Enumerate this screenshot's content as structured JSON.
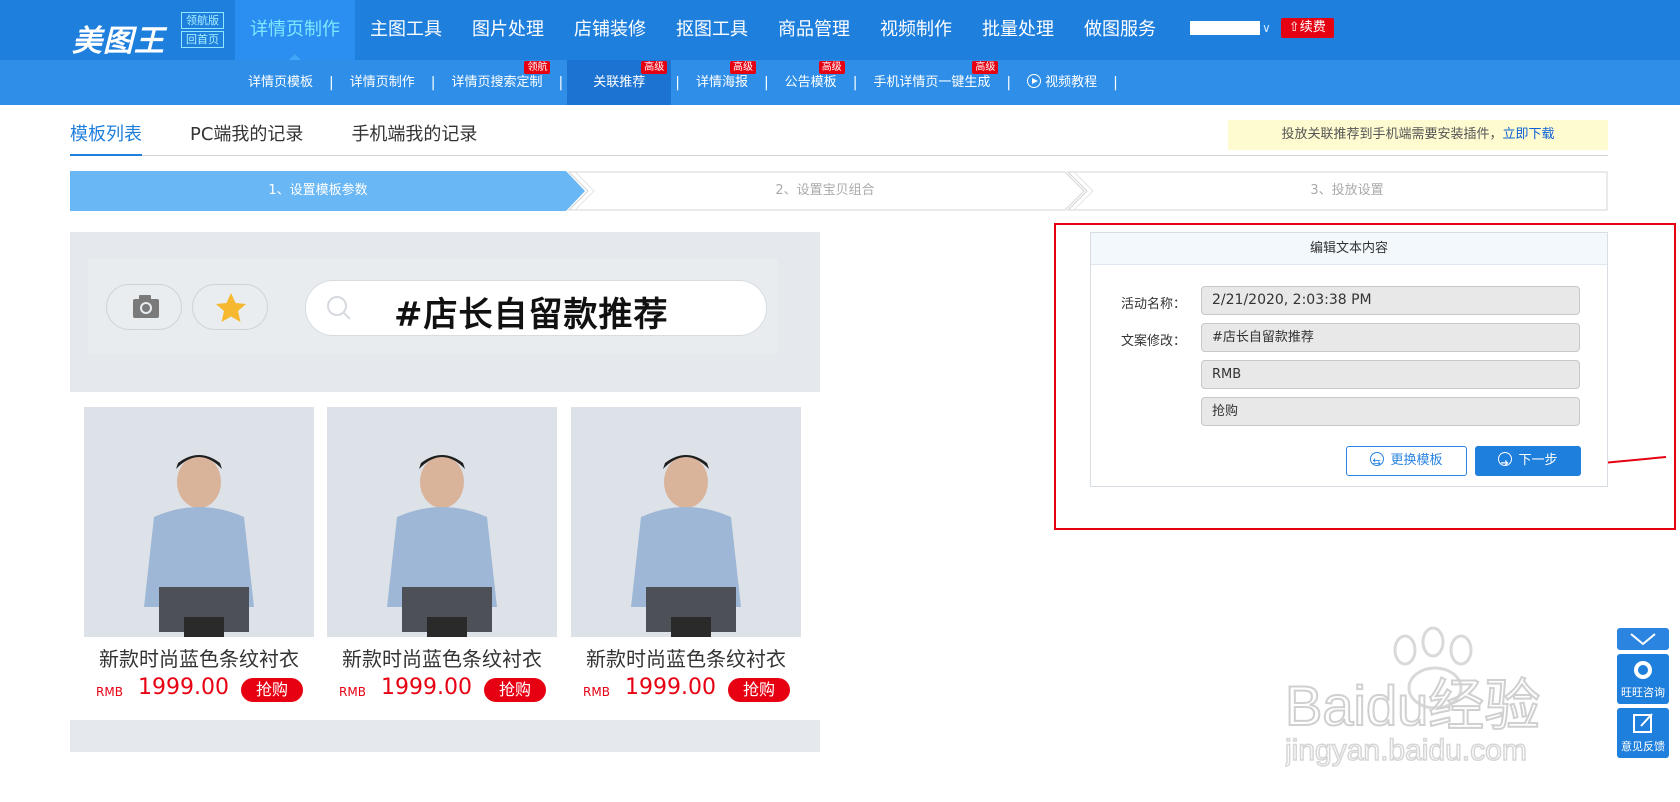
{
  "topbar": {
    "brand": "美图王",
    "badge_top": "领航版",
    "badge_bottom": "回首页",
    "nav": [
      {
        "label": "详情页制作",
        "active": true
      },
      {
        "label": "主图工具"
      },
      {
        "label": "图片处理"
      },
      {
        "label": "店铺装修"
      },
      {
        "label": "抠图工具"
      },
      {
        "label": "商品管理"
      },
      {
        "label": "视频制作"
      },
      {
        "label": "批量处理"
      },
      {
        "label": "做图服务"
      }
    ],
    "user_caret": "∨",
    "renew_label": "续费"
  },
  "subnav": [
    {
      "label": "详情页模板"
    },
    {
      "label": "详情页制作"
    },
    {
      "label": "详情页搜索定制",
      "tag": "领航"
    },
    {
      "label": "关联推荐",
      "tag": "高级",
      "active": true
    },
    {
      "label": "详情海报",
      "tag": "高级"
    },
    {
      "label": "公告模板",
      "tag": "高级"
    },
    {
      "label": "手机详情页一键生成",
      "tag": "高级"
    },
    {
      "label": "视频教程"
    }
  ],
  "tabs": [
    {
      "label": "模板列表",
      "active": true
    },
    {
      "label": "PC端我的记录"
    },
    {
      "label": "手机端我的记录"
    }
  ],
  "notice": {
    "text": "投放关联推荐到手机端需要安装插件，",
    "link": "立即下载"
  },
  "steps": [
    {
      "label": "1、设置模板参数",
      "active": true
    },
    {
      "label": "2、设置宝贝组合"
    },
    {
      "label": "3、投放设置"
    }
  ],
  "preview": {
    "search_text": "#店长自留款推荐",
    "products": [
      {
        "name": "新款时尚蓝色条纹衬衣",
        "currency": "RMB",
        "price": "1999.00",
        "buy": "抢购"
      },
      {
        "name": "新款时尚蓝色条纹衬衣",
        "currency": "RMB",
        "price": "1999.00",
        "buy": "抢购"
      },
      {
        "name": "新款时尚蓝色条纹衬衣",
        "currency": "RMB",
        "price": "1999.00",
        "buy": "抢购"
      }
    ]
  },
  "panel": {
    "title": "编辑文本内容",
    "activity_label": "活动名称：",
    "activity_value": "2/21/2020, 2:03:38 PM",
    "copy_label": "文案修改：",
    "copy_values": [
      "#店长自留款推荐",
      "RMB",
      "抢购"
    ],
    "change_template": "更换模板",
    "next_step": "下一步"
  },
  "side_widgets": {
    "consult": "旺旺咨询",
    "feedback": "意见反馈"
  },
  "watermark": {
    "brand": "Baidu经验",
    "url": "jingyan.baidu.com"
  },
  "colors": {
    "brand_blue": "#1f7fdd",
    "sub_blue": "#2e8ee8",
    "accent_cyan": "#7fe7ff",
    "step_active": "#6ab7f5",
    "price_red": "#e60012",
    "highlight_red": "#e60012"
  }
}
